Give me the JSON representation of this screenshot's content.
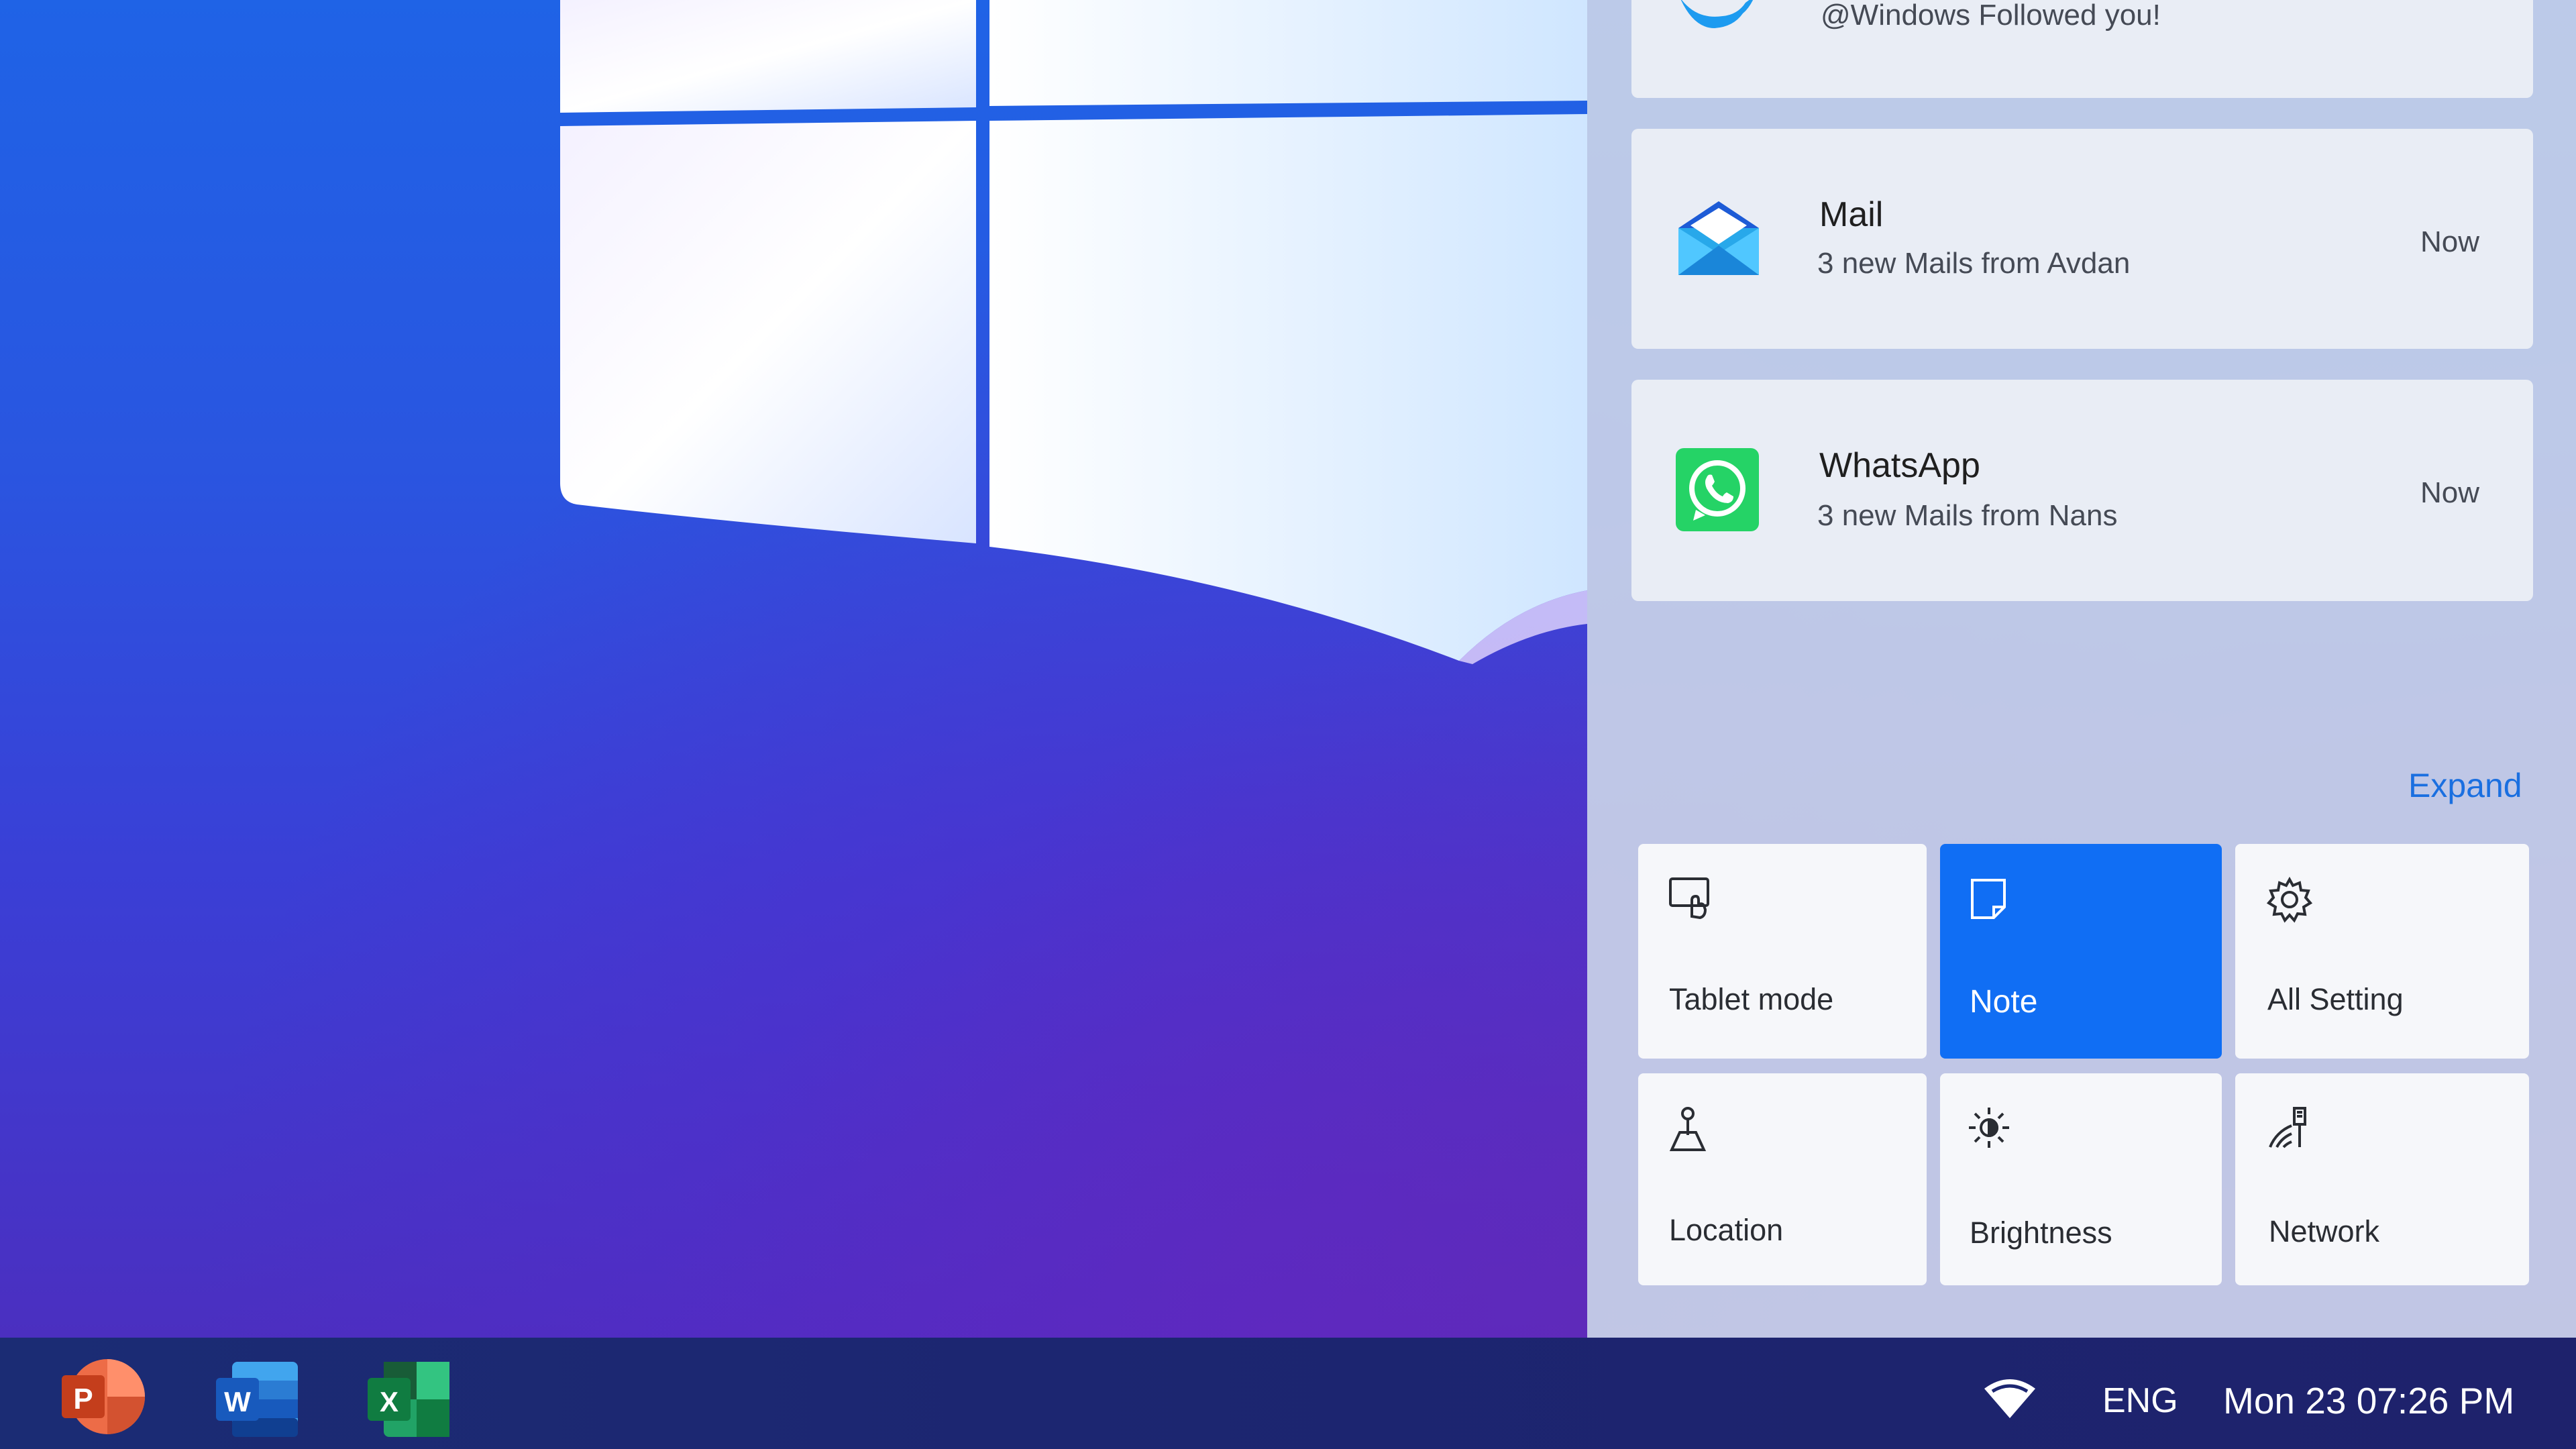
{
  "colors": {
    "accent": "#106ef4",
    "link": "#1a6fe0",
    "taskbar": "#1c2671",
    "panel": "#c8d2e8"
  },
  "notifications": [
    {
      "app": "",
      "icon": "twitter-icon",
      "body": "@Windows Followed you!",
      "time": ""
    },
    {
      "app": "Mail",
      "icon": "mail-icon",
      "body": "3 new Mails from Avdan",
      "time": "Now"
    },
    {
      "app": "WhatsApp",
      "icon": "whatsapp-icon",
      "body": "3 new Mails from Nans",
      "time": "Now"
    }
  ],
  "expand_label": "Expand",
  "quick_actions": [
    {
      "label": "Tablet mode",
      "icon": "tablet-mode-icon",
      "active": false
    },
    {
      "label": "Note",
      "icon": "note-icon",
      "active": true
    },
    {
      "label": "All Setting",
      "icon": "gear-icon",
      "active": false
    },
    {
      "label": "Location",
      "icon": "location-icon",
      "active": false
    },
    {
      "label": "Brightness",
      "icon": "brightness-icon",
      "active": false
    },
    {
      "label": "Network",
      "icon": "network-icon",
      "active": false
    }
  ],
  "taskbar": {
    "apps": [
      {
        "name": "PowerPoint",
        "icon": "powerpoint-icon",
        "letter": "P"
      },
      {
        "name": "Word",
        "icon": "word-icon",
        "letter": "W"
      },
      {
        "name": "Excel",
        "icon": "excel-icon",
        "letter": "X"
      }
    ],
    "tray": {
      "wifi_icon": "wifi-icon",
      "language": "ENG",
      "clock": "Mon 23 07:26 PM"
    }
  }
}
